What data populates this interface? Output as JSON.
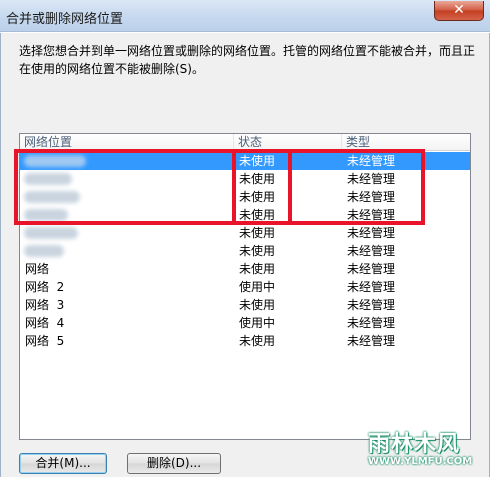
{
  "window": {
    "title": "合并或删除网络位置",
    "close_glyph": "✕"
  },
  "description": "选择您想合并到单一网络位置或删除的网络位置。托管的网络位置不能被合并，而且正在使用的网络位置不能被删除(S)。",
  "list": {
    "columns": [
      "网络位置",
      "状态",
      "类型"
    ],
    "rows": [
      {
        "location": "",
        "status": "未使用",
        "type": "未经管理",
        "selected": true
      },
      {
        "location": "",
        "status": "未使用",
        "type": "未经管理"
      },
      {
        "location": "",
        "status": "未使用",
        "type": "未经管理"
      },
      {
        "location": "",
        "status": "未使用",
        "type": "未经管理"
      },
      {
        "location": "",
        "status": "未使用",
        "type": "未经管理"
      },
      {
        "location": "",
        "status": "未使用",
        "type": "未经管理"
      },
      {
        "location": "网络",
        "status": "未使用",
        "type": "未经管理"
      },
      {
        "location": "网络  2",
        "status": "使用中",
        "type": "未经管理"
      },
      {
        "location": "网络  3",
        "status": "未使用",
        "type": "未经管理"
      },
      {
        "location": "网络  4",
        "status": "使用中",
        "type": "未经管理"
      },
      {
        "location": "网络  5",
        "status": "未使用",
        "type": "未经管理"
      }
    ]
  },
  "buttons": {
    "merge": "合并(M)...",
    "delete": "删除(D)..."
  },
  "watermark": {
    "brand": "雨林木风",
    "url": "WWW.YLMFU.COM"
  },
  "colors": {
    "selection": "#3399ff",
    "highlight": "#e8142a"
  }
}
